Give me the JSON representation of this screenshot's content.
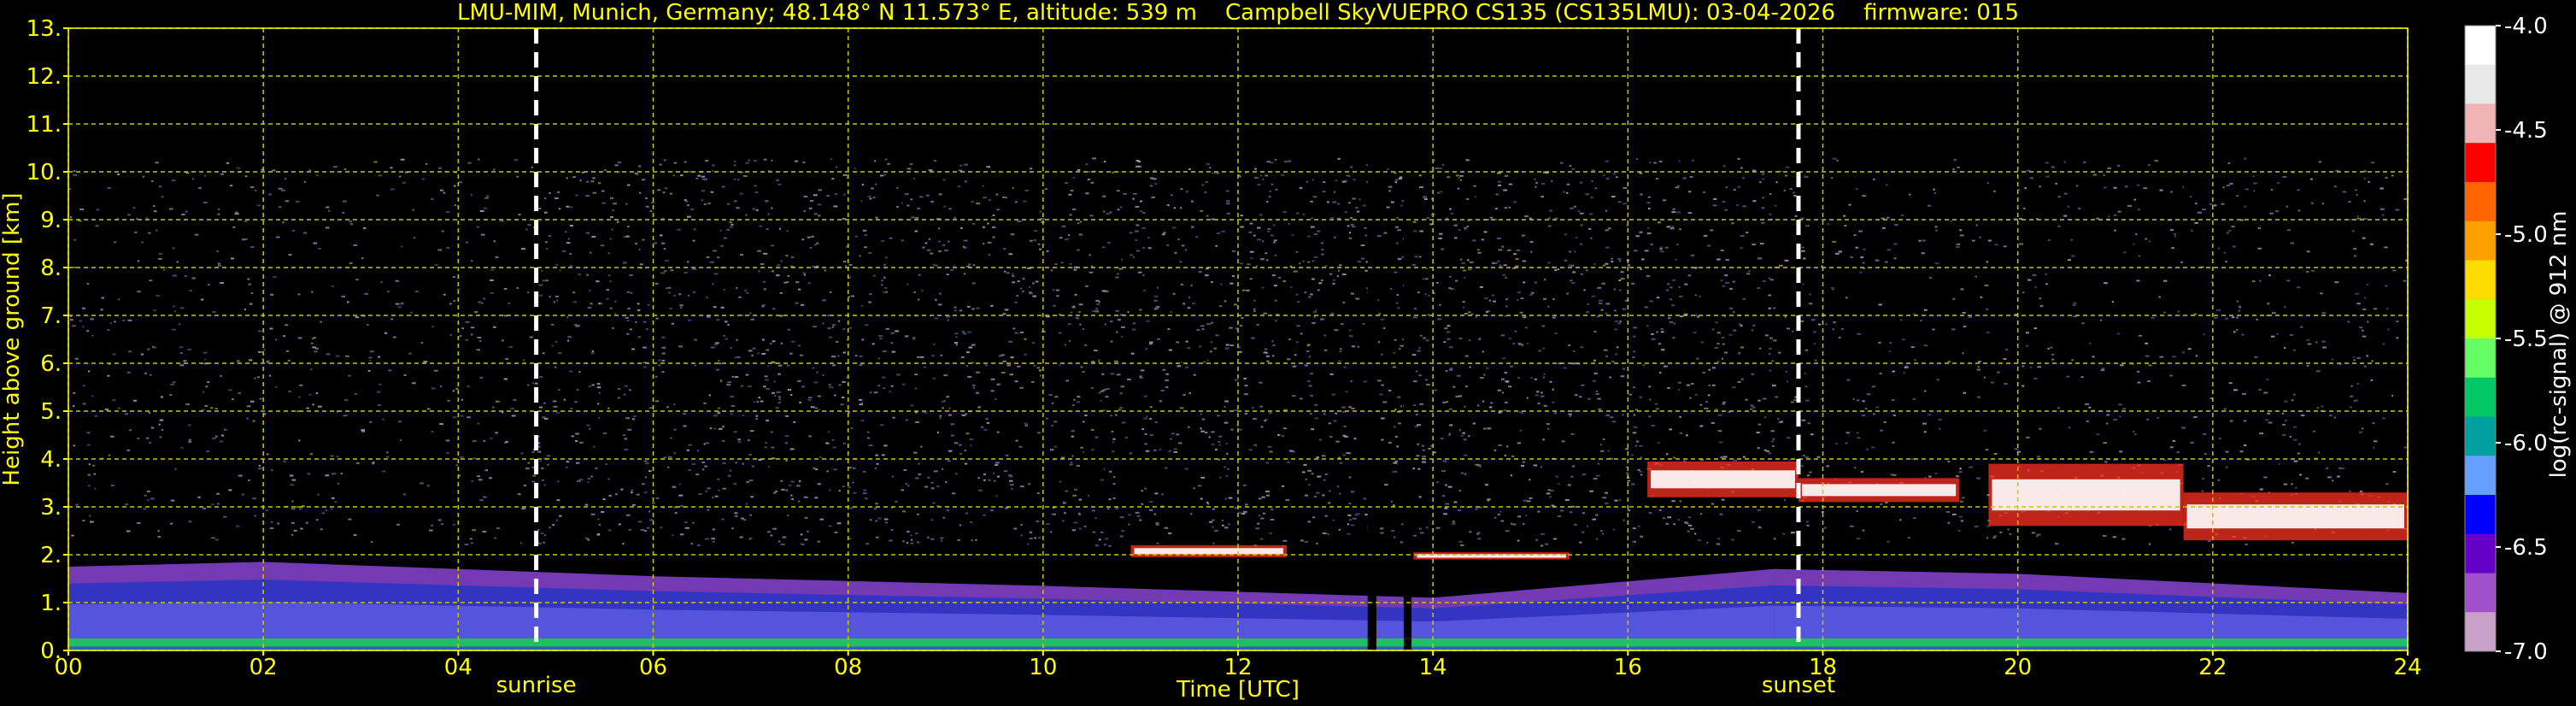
{
  "chart_data": {
    "type": "heatmap",
    "title": "LMU-MIM, Munich, Germany; 48.148° N 11.573° E, altitude: 539 m    Campbell SkyVUEPRO CS135 (CS135LMU): 03-04-2026    firmware: 015",
    "xlabel": "Time [UTC]",
    "ylabel": "Height above ground [km]",
    "colorbar_label": "log(rc-signal) @ 912 nm",
    "xlim": [
      0,
      24
    ],
    "ylim": [
      0,
      13
    ],
    "x_ticks": [
      "00",
      "02",
      "04",
      "06",
      "08",
      "10",
      "12",
      "14",
      "16",
      "18",
      "20",
      "22",
      "24"
    ],
    "y_ticks": [
      "0.",
      "1.",
      "2.",
      "3.",
      "4.",
      "5.",
      "6.",
      "7.",
      "8.",
      "9.",
      "10.",
      "11.",
      "12.",
      "13."
    ],
    "colorbar_range": [
      -7.0,
      -4.0
    ],
    "colorbar_ticks": [
      "-4.0",
      "-4.5",
      "-5.0",
      "-5.5",
      "-6.0",
      "-6.5",
      "-7.0"
    ],
    "grid": true,
    "annotations": [
      {
        "label": "sunrise",
        "time": 4.8
      },
      {
        "label": "sunset",
        "time": 17.75
      }
    ],
    "data_gaps": [
      [
        13.33,
        13.42
      ],
      [
        13.7,
        13.78
      ]
    ],
    "max_range_km": 10.3,
    "features": {
      "boundary_layer_top_km": [
        {
          "time": 0.0,
          "height": 1.75
        },
        {
          "time": 2.0,
          "height": 1.85
        },
        {
          "time": 4.0,
          "height": 1.7
        },
        {
          "time": 6.0,
          "height": 1.55
        },
        {
          "time": 10.0,
          "height": 1.35
        },
        {
          "time": 14.0,
          "height": 1.1
        },
        {
          "time": 17.5,
          "height": 1.7
        },
        {
          "time": 20.0,
          "height": 1.6
        },
        {
          "time": 24.0,
          "height": 1.2
        }
      ],
      "cloud_layers": [
        {
          "start": 10.9,
          "end": 12.5,
          "base_km": 1.95,
          "top_km": 2.2
        },
        {
          "start": 13.8,
          "end": 15.4,
          "base_km": 1.9,
          "top_km": 2.05
        },
        {
          "start": 16.2,
          "end": 17.75,
          "base_km": 3.2,
          "top_km": 3.95
        },
        {
          "start": 17.75,
          "end": 19.4,
          "base_km": 3.1,
          "top_km": 3.6
        },
        {
          "start": 19.7,
          "end": 21.7,
          "base_km": 2.6,
          "top_km": 3.9
        },
        {
          "start": 21.7,
          "end": 24.0,
          "base_km": 2.3,
          "top_km": 3.3
        }
      ]
    }
  },
  "colors": {
    "background": "#000000",
    "text": "#ffff00",
    "grid": "#c8c800",
    "colorbar": [
      "#ffffff",
      "#e8e8e8",
      "#f0b4b4",
      "#ff0000",
      "#ff6400",
      "#ffa000",
      "#ffdc00",
      "#c8ff00",
      "#64ff64",
      "#00c864",
      "#00a0a0",
      "#64a0ff",
      "#0000ff",
      "#6400c8",
      "#a050c8",
      "#c8a0c8"
    ]
  }
}
